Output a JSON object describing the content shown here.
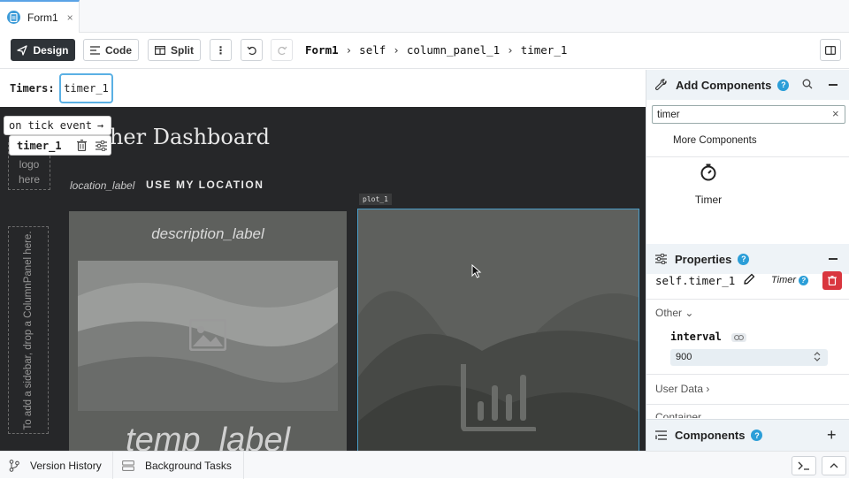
{
  "tab": {
    "title": "Form1",
    "close": "×"
  },
  "toolbar": {
    "design_label": "Design",
    "code_label": "Code",
    "split_label": "Split",
    "more_icon": "⋮",
    "breadcrumb": [
      "Form1",
      "self",
      "column_panel_1",
      "timer_1"
    ]
  },
  "timers_bar": {
    "label": "Timers:",
    "chip": "timer_1"
  },
  "canvas": {
    "title": "ather Dashboard",
    "logo_text": [
      "logo",
      "here"
    ],
    "sidebar_hint": "To add a sidebar, drop a ColumnPanel here.",
    "location_label": "location_label",
    "location_button": "USE MY LOCATION",
    "description_label": "description_label",
    "temp_label": "temp_label",
    "plot_tag": "plot_1"
  },
  "popup": {
    "event": "on tick event",
    "event_arrow": "→",
    "name": "timer_1"
  },
  "add_components": {
    "title": "Add Components",
    "help": "?",
    "search_value": "timer",
    "clear": "×",
    "more": "More Components",
    "result_label": "Timer"
  },
  "properties": {
    "title": "Properties",
    "help": "?",
    "name": "self.timer_1",
    "type": "Timer",
    "section_other": "Other",
    "interval_label": "interval",
    "interval_value": "900",
    "section_user_data": "User Data",
    "section_container": "Container"
  },
  "components_panel": {
    "title": "Components",
    "help": "?",
    "add": "+"
  },
  "bottom": {
    "version_history": "Version History",
    "background_tasks": "Background Tasks"
  },
  "colors": {
    "accent": "#2b9ed8",
    "active_btn": "#2e3338",
    "canvas_bg": "#262729",
    "delete": "#d9363e"
  }
}
